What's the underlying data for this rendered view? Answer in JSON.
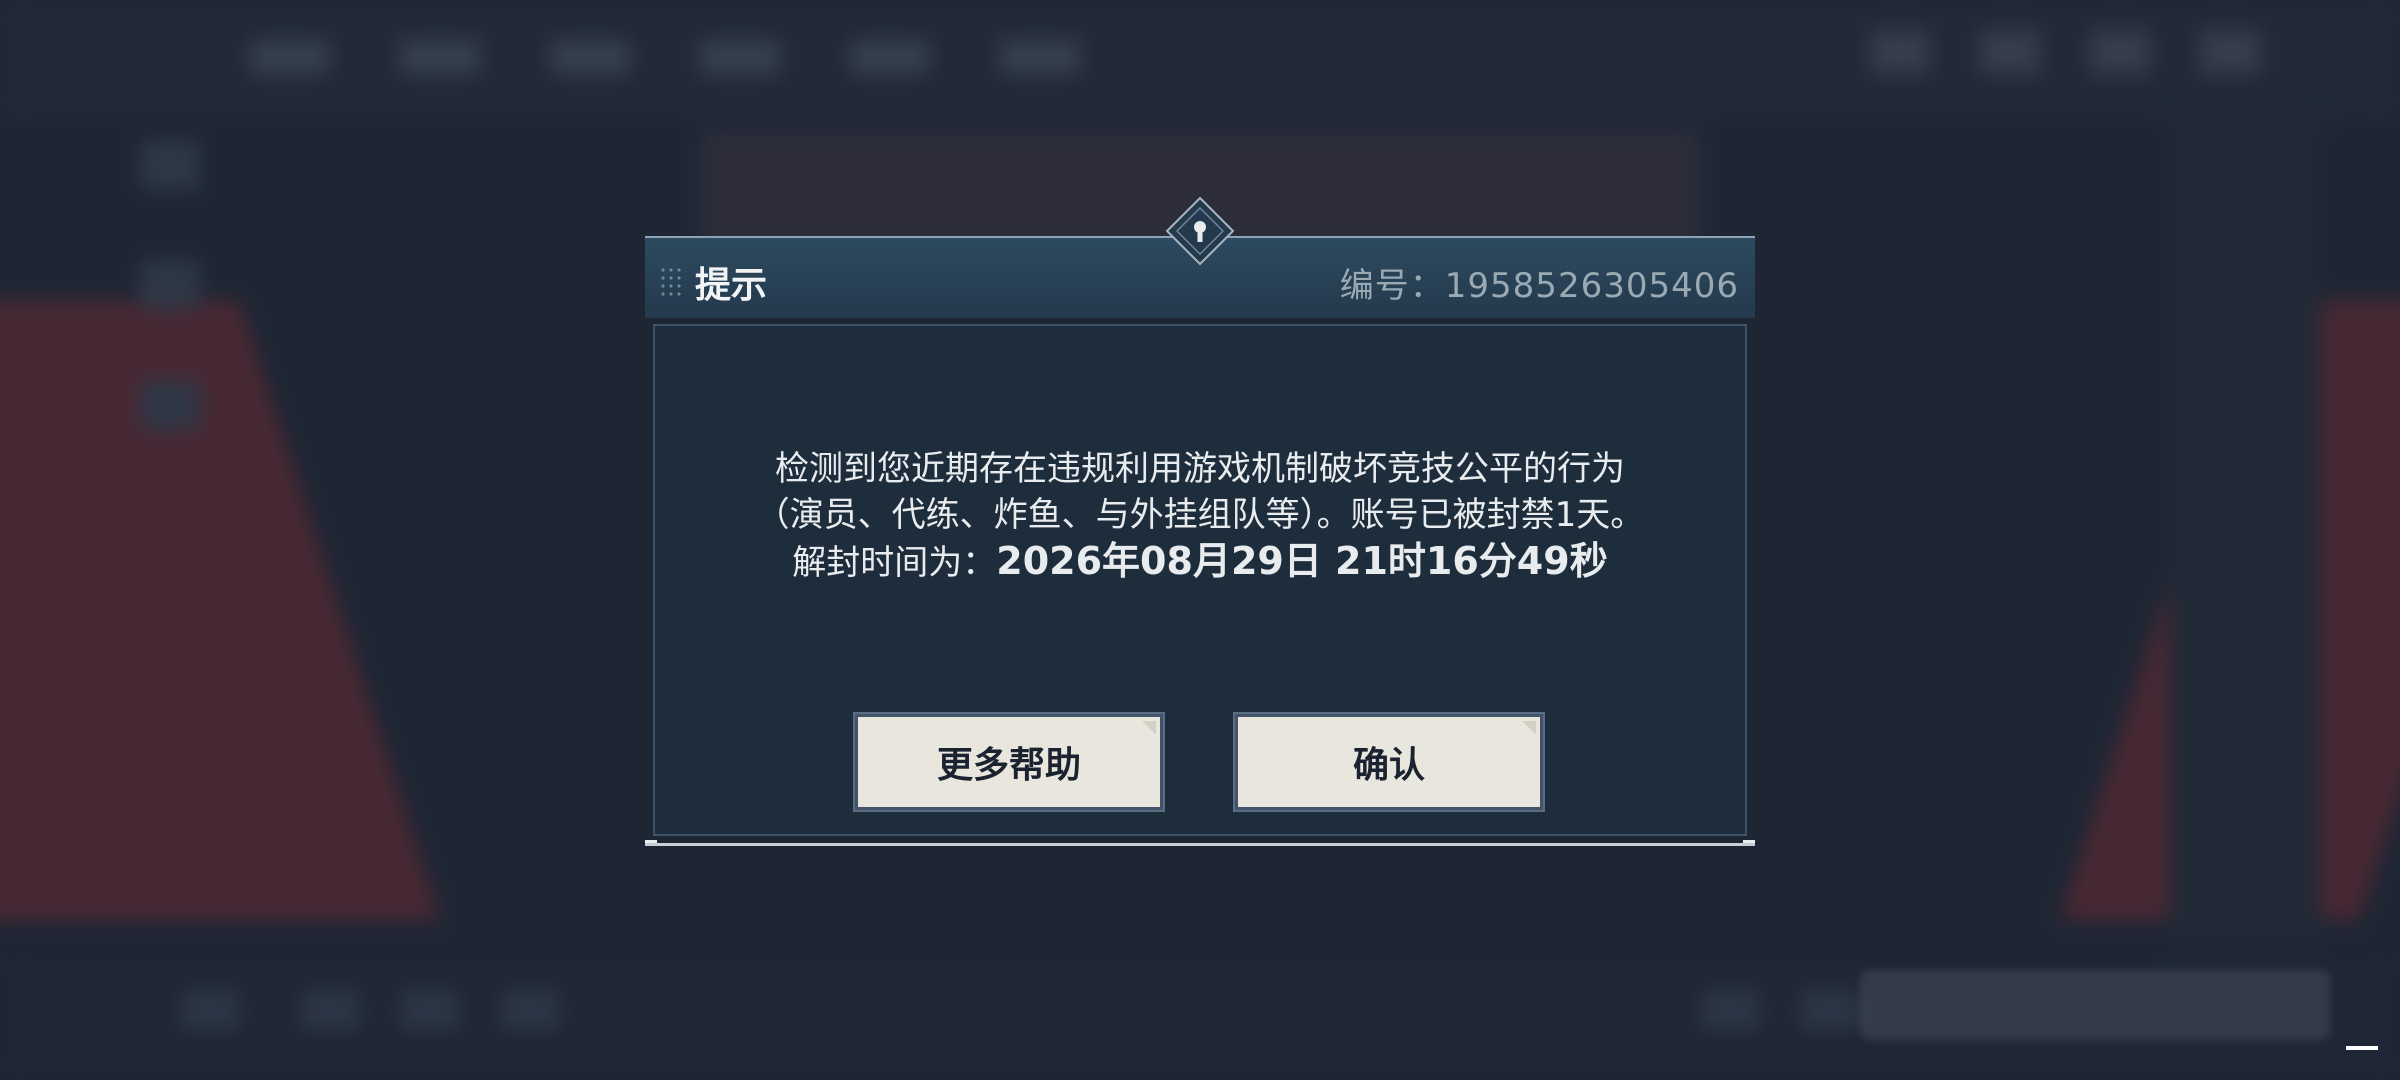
{
  "dialog": {
    "title": "提示",
    "id_label": "编号：",
    "id_value": "1958526305406",
    "message_line1": "检测到您近期存在违规利用游戏机制破坏竞技公平的行为",
    "message_line2": "（演员、代练、炸鱼、与外挂组队等）。账号已被封禁1天。",
    "message_line3_prefix": "解封时间为：",
    "unban_time": "2026年08月29日 21时16分49秒",
    "help_button": "更多帮助",
    "confirm_button": "确认"
  },
  "colors": {
    "header_bg": "#2d4a60",
    "body_bg": "#1e2d3c",
    "button_bg": "#e9e6de",
    "text_light": "#e9ecee",
    "id_text": "#9aa9b2"
  },
  "icons": {
    "emblem": "diamond-emblem-icon",
    "grip": "drag-grip-icon"
  }
}
